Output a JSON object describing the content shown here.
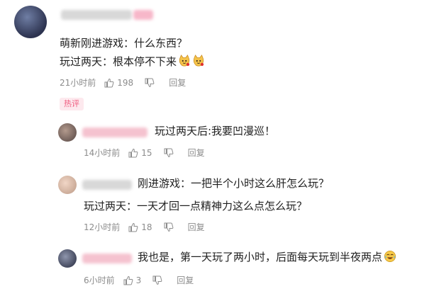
{
  "comments": [
    {
      "lines": [
        "萌新刚进游戏：什么东西？",
        "玩过两天：根本停不下来"
      ],
      "emoji": [
        "cat-face-emoji",
        "cat-face-emoji"
      ],
      "time": "21小时前",
      "likes": "198",
      "reply_label": "回复",
      "badge": "热评"
    },
    {
      "lines": [
        "玩过两天后:我要凹漫巡！"
      ],
      "time": "14小时前",
      "likes": "15",
      "reply_label": "回复"
    },
    {
      "lines": [
        "刚进游戏：一把半个小时这么肝怎么玩？",
        "玩过两天：一天才回一点精神力这么点怎么玩？"
      ],
      "time": "12小时前",
      "likes": "18",
      "reply_label": "回复"
    },
    {
      "lines": [
        "我也是，第一天玩了两小时，后面每天玩到半夜两点"
      ],
      "emoji": [
        "crying-laughing-emoji"
      ],
      "time": "6小时前",
      "likes": "3",
      "reply_label": "回复"
    }
  ],
  "colors": {
    "text": "#1f1f1f",
    "meta": "#8c8c8c",
    "badge_text": "#f05a7e",
    "badge_bg": "#fde9ee"
  }
}
